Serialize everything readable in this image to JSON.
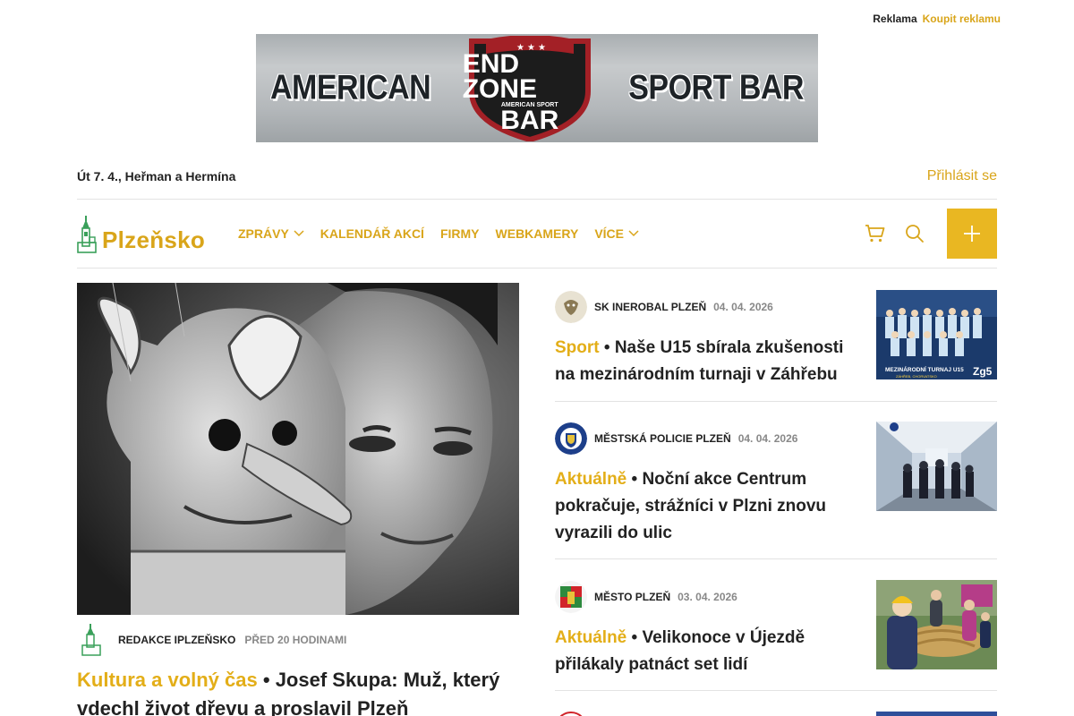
{
  "top_links": {
    "ad": "Reklama",
    "buy_ad": "Koupit reklamu"
  },
  "banner": {
    "left": "AMERICAN",
    "shield_top": "END ZONE",
    "shield_small": "AMERICAN SPORT",
    "shield_bottom": "BAR",
    "right": "SPORT BAR"
  },
  "header": {
    "date": "Út 7. 4., Heřman a Hermína",
    "login": "Přihlásit se"
  },
  "logo": {
    "text": "Plzeňsko"
  },
  "menu": [
    {
      "label": "ZPRÁVY",
      "dropdown": true
    },
    {
      "label": "KALENDÁŘ AKCÍ",
      "dropdown": false
    },
    {
      "label": "FIRMY",
      "dropdown": false
    },
    {
      "label": "WEBKAMERY",
      "dropdown": false
    },
    {
      "label": "VÍCE",
      "dropdown": true
    }
  ],
  "colors": {
    "accent": "#e3ae18",
    "plus_button": "#e9b722"
  },
  "hero": {
    "author": "REDAKCE IPLZEŇSKO",
    "time": "PŘED 20 HODINAMI",
    "category": "Kultura a volný čas",
    "title": "• Josef Skupa: Muž, který vdechl život dřevu a proslavil Plzeň"
  },
  "articles": [
    {
      "source": "SK INEROBAL PLZEŇ",
      "date": "04. 04. 2026",
      "category": "Sport",
      "title": "• Naše U15 sbírala zkušenosti na mezinárodním turnaji v Záhřebu",
      "thumb_caption": "MEZINÁRODNÍ TURNAJ U15",
      "thumb_sub": "ZÁHŘEB, CHORVATSKO",
      "thumb_badge": "Zg5"
    },
    {
      "source": "MĚSTSKÁ POLICIE PLZEŇ",
      "date": "04. 04. 2026",
      "category": "Aktuálně",
      "title": "• Noční akce Centrum pokračuje, strážníci v Plzni znovu vyrazili do ulic"
    },
    {
      "source": "MĚSTO PLZEŇ",
      "date": "03. 04. 2026",
      "category": "Aktuálně",
      "title": "• Velikonoce v Újezdě přilákaly patnáct set lidí"
    }
  ]
}
